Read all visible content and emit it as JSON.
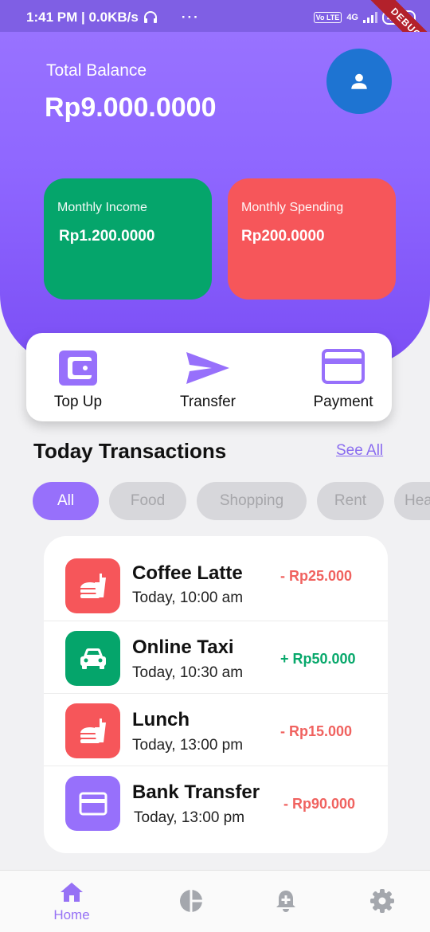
{
  "status_bar": {
    "time_speed": "1:41 PM | 0.0KB/s",
    "dots": "···",
    "volte": "Vo LTE",
    "network": "4G",
    "battery": "43",
    "debug": "DEBUG"
  },
  "header": {
    "balance_label": "Total Balance",
    "balance_value": "Rp9.000.0000",
    "avatar_icon": "person-icon"
  },
  "stats": {
    "income": {
      "title": "Monthly Income",
      "value": "Rp1.200.0000",
      "color": "#05a56b"
    },
    "spending": {
      "title": "Monthly Spending",
      "value": "Rp200.0000",
      "color": "#f6565a"
    }
  },
  "actions": [
    {
      "label": "Top Up",
      "icon": "wallet-icon"
    },
    {
      "label": "Transfer",
      "icon": "send-icon"
    },
    {
      "label": "Payment",
      "icon": "credit-card-icon"
    }
  ],
  "section": {
    "title": "Today Transactions",
    "see_all": "See All"
  },
  "filters": [
    "All",
    "Food",
    "Shopping",
    "Rent",
    "Hea"
  ],
  "transactions": [
    {
      "name": "Coffee Latte",
      "time": "Today, 10:00 am",
      "amount": "- Rp25.000",
      "icon": "fastfood-icon",
      "color": "#f6565a",
      "amount_color": "#f0625f"
    },
    {
      "name": "Online Taxi",
      "time": "Today, 10:30 am",
      "amount": "+ Rp50.000",
      "icon": "car-icon",
      "color": "#05a56b",
      "amount_color": "#07a86b"
    },
    {
      "name": "Lunch",
      "time": "Today, 13:00 pm",
      "amount": "- Rp15.000",
      "icon": "fastfood-icon",
      "color": "#f6565a",
      "amount_color": "#f0625f"
    },
    {
      "name": "Bank Transfer",
      "time": "Today, 13:00 pm",
      "amount": "- Rp90.000",
      "icon": "credit-card-icon",
      "color": "#9770fb",
      "amount_color": "#f0625f"
    }
  ],
  "bottom_nav": {
    "home_label": "Home",
    "items": [
      "home-icon",
      "pie-chart-icon",
      "notification-add-icon",
      "settings-icon"
    ]
  },
  "colors": {
    "accent": "#9770fb",
    "header": "#8f67ff"
  }
}
